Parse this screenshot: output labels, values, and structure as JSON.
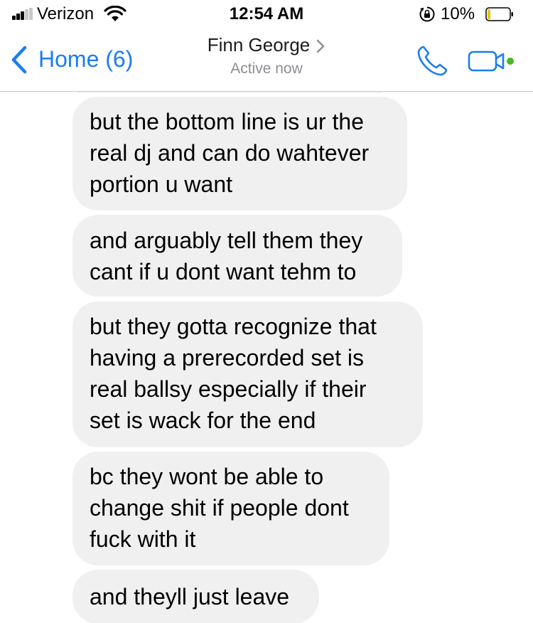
{
  "status_bar": {
    "carrier": "Verizon",
    "time": "12:54 AM",
    "battery_percent": "10%",
    "signal_bars_filled": 3,
    "signal_bars_total": 5,
    "battery_level": 0.1,
    "icons": [
      "signal-icon",
      "wifi-icon",
      "rotation-lock-icon",
      "battery-icon"
    ]
  },
  "nav": {
    "back_label": "Home (6)",
    "contact_name": "Finn George",
    "contact_status": "Active now",
    "icons": [
      "back-chevron-icon",
      "chevron-right-icon",
      "phone-icon",
      "video-call-icon"
    ],
    "active_dot_color": "#44bb22",
    "accent_color": "#1a7cf5"
  },
  "messages": [
    {
      "text": ""
    },
    {
      "text": "but the bottom line is ur the\nreal dj and can do wahtever\nportion u want"
    },
    {
      "text": "and arguably tell them they\ncant if u dont want tehm to"
    },
    {
      "text": "but they gotta recognize that\nhaving a prerecorded set is\nreal ballsy especially if their\nset is wack for the end"
    },
    {
      "text": "bc they wont be able to\nchange shit if people dont\nfuck with it"
    },
    {
      "text": "and theyll just leave"
    }
  ],
  "colors": {
    "bubble": "#f1f0f0",
    "subtitle": "#8e8e93"
  }
}
